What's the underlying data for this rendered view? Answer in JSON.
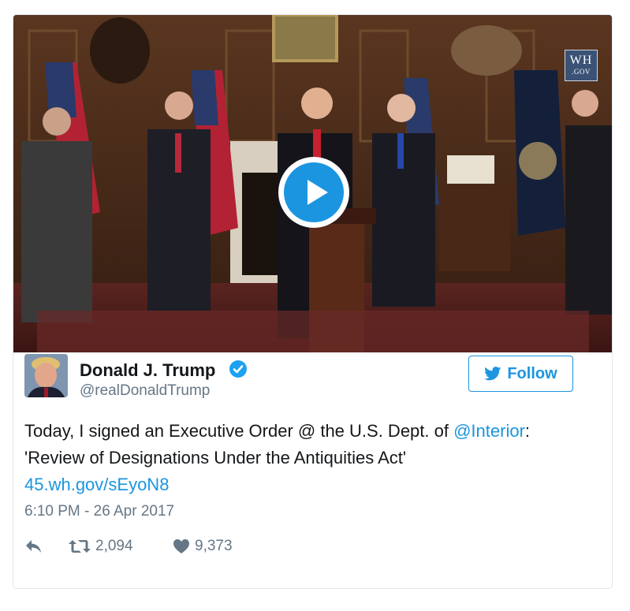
{
  "media": {
    "watermark_top": "WH",
    "watermark_bottom": ".GOV",
    "play_button": "play-icon"
  },
  "author": {
    "name": "Donald J. Trump",
    "handle": "@realDonaldTrump",
    "verified_icon": "verified-badge-icon"
  },
  "follow_button": {
    "label": "Follow",
    "icon": "twitter-bird-icon",
    "color": "#1b95e0"
  },
  "tweet": {
    "text_before": "Today, I signed an Executive Order @ the U.S. Dept. of ",
    "mention": "@Interior",
    "text_after": ": 'Review of Designations Under the Antiquities Act'",
    "link": "45.wh.gov/sEyoN8",
    "timestamp": "6:10 PM - 26 Apr 2017"
  },
  "actions": {
    "reply_icon": "reply-icon",
    "retweet_icon": "retweet-icon",
    "retweet_count": "2,094",
    "like_icon": "heart-icon",
    "like_count": "9,373"
  },
  "colors": {
    "link": "#1b95e0",
    "secondary_text": "#657786",
    "verified": "#1da1f2"
  }
}
